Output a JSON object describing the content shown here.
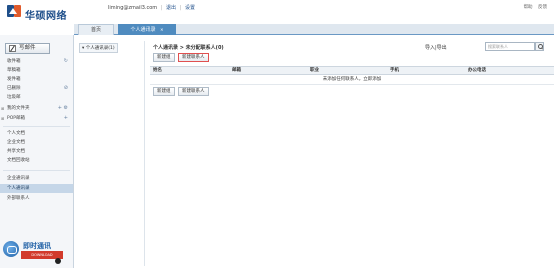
{
  "brand": {
    "name": "华硕网络"
  },
  "user": {
    "email": "liming@zmail3.com",
    "logout": "退出",
    "settings": "设置"
  },
  "top_links": [
    "帮助",
    "反馈"
  ],
  "tabs": [
    {
      "label": "首页"
    },
    {
      "label": "个人通讯录"
    }
  ],
  "sidebar": {
    "compose_label": "写邮件",
    "folders": [
      {
        "label": "收件箱"
      },
      {
        "label": "草稿箱"
      },
      {
        "label": "发件箱"
      },
      {
        "label": "已删除"
      },
      {
        "label": "垃圾邮"
      },
      {
        "label": "我的文件夹"
      },
      {
        "label": "POP邮箱"
      }
    ],
    "tools": [
      {
        "label": "个人文档"
      },
      {
        "label": "企业文档"
      },
      {
        "label": "共享文档"
      },
      {
        "label": "文档回收站"
      }
    ],
    "contacts": [
      {
        "label": "企业通讯录"
      },
      {
        "label": "个人通讯录"
      },
      {
        "label": "外部联系人"
      }
    ]
  },
  "im_widget": {
    "title": "即时通讯",
    "badge": "DOWNLOAD"
  },
  "group_panel": {
    "item": "个人通讯录(1)"
  },
  "content": {
    "breadcrumb": "个人通讯录 > 未分配联系人(0)",
    "import_export": "导入|导出",
    "search_placeholder": "搜索联系人",
    "toolbar_top": {
      "new_group": "新建组",
      "new_contact": "新建联系人"
    },
    "columns": [
      "姓名",
      "邮箱",
      "职业",
      "手机",
      "办公电话"
    ],
    "empty_message": "未添加任何联系人，立即添加",
    "toolbar_bottom": {
      "new_group": "新建组",
      "new_contact": "新建联系人"
    }
  }
}
